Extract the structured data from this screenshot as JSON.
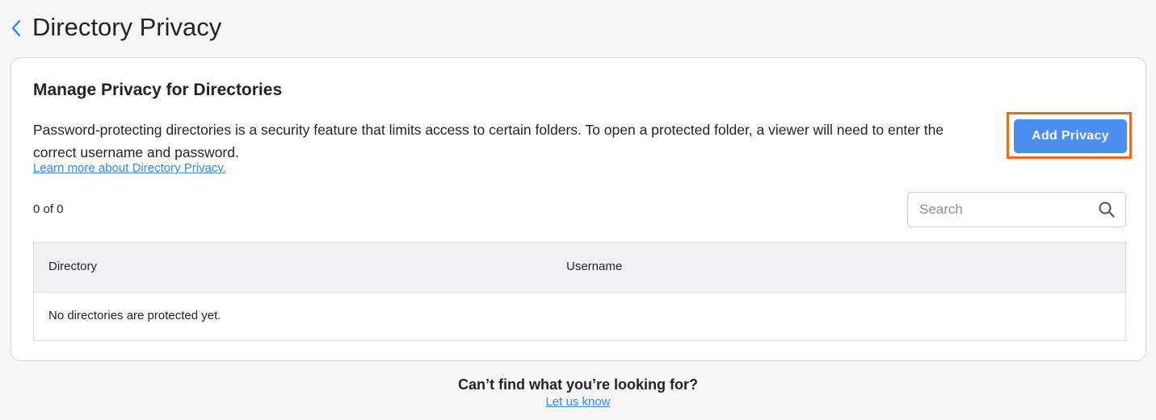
{
  "header": {
    "title": "Directory Privacy",
    "back_icon": "chevron-left-icon"
  },
  "card": {
    "title": "Manage Privacy for Directories",
    "description": "Password-protecting directories is a security feature that limits access to certain folders. To open a protected folder, a viewer will need to enter the correct username and password.",
    "learn_more_link": "Learn more about Directory Privacy.",
    "add_button_label": "Add Privacy",
    "count_text": "0 of 0",
    "search": {
      "placeholder": "Search",
      "value": "",
      "icon": "search-icon"
    },
    "table": {
      "columns": [
        "Directory",
        "Username"
      ],
      "rows": [],
      "empty_message": "No directories are protected yet."
    }
  },
  "footer": {
    "question": "Can’t find what you’re looking for?",
    "link": "Let us know"
  },
  "colors": {
    "accent": "#4a8ff0",
    "link": "#3a86e8",
    "highlight": "#ea6a1e",
    "background": "#f7f7f8"
  }
}
